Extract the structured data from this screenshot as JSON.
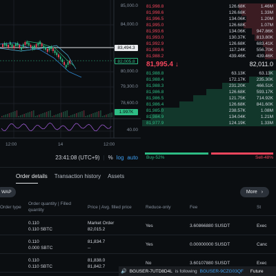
{
  "chart": {
    "price_axis": [
      "80,000.0",
      "79,300.0",
      "78,600.0"
    ],
    "price_axis_top": [
      "85,000.0",
      "84,000.0"
    ],
    "current_price_tag": "83,494.3",
    "mark_price_tag": "82,005.8",
    "volume_tag": "1.997K",
    "indicator_level": "40.00",
    "x_labels": [
      "12:00",
      "14",
      "12:00"
    ],
    "time": "23:41:08 (UTC+9)",
    "pct_toggle": "%",
    "log_toggle": "log",
    "auto_toggle": "auto"
  },
  "orderbook": {
    "asks": [
      {
        "price": "81,998.8",
        "qty": "126.68K",
        "total": "1.46M",
        "depth": 0.28
      },
      {
        "price": "81,998.6",
        "qty": "126.68K",
        "total": "1.33M",
        "depth": 0.26
      },
      {
        "price": "81,996.5",
        "qty": "134.06K",
        "total": "1.20M",
        "depth": 0.22
      },
      {
        "price": "81,995.0",
        "qty": "126.68K",
        "total": "1.07M",
        "depth": 0.24
      },
      {
        "price": "81,993.6",
        "qty": "134.06K",
        "total": "947.86K",
        "depth": 0.18
      },
      {
        "price": "81,993.0",
        "qty": "130.37K",
        "total": "813.80K",
        "depth": 0.16
      },
      {
        "price": "81,992.9",
        "qty": "126.68K",
        "total": "683.41K",
        "depth": 0.1
      },
      {
        "price": "81,989.6",
        "qty": "117.24K",
        "total": "556.70K",
        "depth": 0.08
      },
      {
        "price": "81,988.2",
        "qty": "439.46K",
        "total": "439.46K",
        "depth": 0.08
      }
    ],
    "last_price": "81,995.4",
    "last_arrow": "↓",
    "mark_price": "82,011.0",
    "bids": [
      {
        "price": "81,988.8",
        "qty": "63.13K",
        "total": "63.13K",
        "depth": 0.05
      },
      {
        "price": "81,988.4",
        "qty": "172.17K",
        "total": "235.30K",
        "depth": 0.2
      },
      {
        "price": "81,988.3",
        "qty": "231.20K",
        "total": "466.51K",
        "depth": 0.4
      },
      {
        "price": "81,986.8",
        "qty": "126.68K",
        "total": "593.17K",
        "depth": 0.52
      },
      {
        "price": "81,986.5",
        "qty": "121.75K",
        "total": "714.92K",
        "depth": 0.62
      },
      {
        "price": "81,986.4",
        "qty": "126.68K",
        "total": "841.60K",
        "depth": 0.72
      },
      {
        "price": "81,985.0",
        "qty": "238.57K",
        "total": "1.08M",
        "depth": 0.86
      },
      {
        "price": "81,984.9",
        "qty": "134.04K",
        "total": "1.21M",
        "depth": 0.94
      },
      {
        "price": "81,977.9",
        "qty": "124.19K",
        "total": "1.33M",
        "depth": 1.0
      }
    ],
    "buy_ratio": "Buy-52%",
    "sell_ratio": "Sell-48%"
  },
  "bottom": {
    "tabs": [
      "Order details",
      "Transaction history",
      "Assets"
    ],
    "filter_chip": "WAP",
    "more_label": "More",
    "more_chevron": "›",
    "headers": {
      "type": "Order type",
      "qty": "Order quantity | Filled quantity",
      "price": "Price | Avg. filled price",
      "reduce": "Reduce-only",
      "fee": "Fee",
      "status": "St"
    },
    "rows": [
      {
        "qty1": "0.110",
        "qty2": "0.110 SBTC",
        "price1": "Market Order",
        "price2": "82,015.2",
        "reduce": "Yes",
        "fee": "3.60866880 SUSDT",
        "status": "Exec"
      },
      {
        "qty1": "0.110",
        "qty2": "0.000 SBTC",
        "price1": "81,834.7",
        "price2": "--",
        "reduce": "Yes",
        "fee": "0.00000000 SUSDT",
        "status": "Canc"
      },
      {
        "qty1": "0.110",
        "qty2": "0.110 SBTC",
        "price1": "81,838.0",
        "price2": "81,842.7",
        "reduce": "No",
        "fee": "3.60107880 SUSDT",
        "status": "Exec"
      }
    ]
  },
  "notice": {
    "speaker": "🔊",
    "who": "BGUSER-7UTD8D4L",
    "verb": "is following",
    "target": "BGUSER-9CZG03QF",
    "tail": "Future"
  },
  "colors": {
    "up": "#2ebd85",
    "down": "#f6465d",
    "accent": "#3d9ff2"
  }
}
